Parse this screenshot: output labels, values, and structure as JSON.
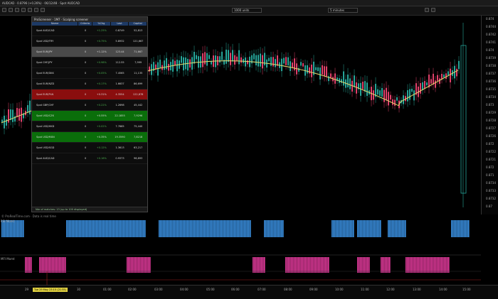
{
  "window": {
    "title": "AUDCAD · 0.8796 (+0.26%) · 06/12/48 · Spot AUDCAD"
  },
  "toolbar": {
    "units_label": "1000 units",
    "timeframe_label": "5 minutes"
  },
  "screener": {
    "header": "ProScreener · 1M7 · Scalping screener",
    "columns": [
      "Name",
      "Criteria",
      "%Chg",
      "Last",
      "Capital"
    ],
    "rows": [
      {
        "name": "Spot AUD/CAD",
        "criteria": "0",
        "chg": "+1.25%",
        "last": "0.8749",
        "cap": "52,813",
        "bg": "#0d0d0d"
      },
      {
        "name": "Spot USD/TRY",
        "criteria": "0",
        "chg": "+0.75%",
        "last": "5.8932",
        "cap": "121,667",
        "bg": "#0d0d0d"
      },
      {
        "name": "Spot EUR/JPY",
        "criteria": "0",
        "chg": "+1.12%",
        "last": "123.44",
        "cap": "71,667",
        "bg": "#4a4a4a"
      },
      {
        "name": "Spot CHF/JPY",
        "criteria": "0",
        "chg": "+0.98%",
        "last": "112.55",
        "cap": "7,999",
        "bg": "#0d0d0d"
      },
      {
        "name": "Spot EUR/DKK",
        "criteria": "0",
        "chg": "+0.05%",
        "last": "7.4565",
        "cap": "11,135",
        "bg": "#0d0d0d"
      },
      {
        "name": "Spot EUR/NZD",
        "criteria": "0",
        "chg": "+0.17%",
        "last": "1.6637",
        "cap": "86,699",
        "bg": "#0d0d0d"
      },
      {
        "name": "Spot EUR/PLN",
        "criteria": "0",
        "chg": "+0.31%",
        "last": "4.3554",
        "cap": "122,878",
        "bg": "#8a0e0e"
      },
      {
        "name": "Spot GBP/CHF",
        "criteria": "0",
        "chg": "+0.22%",
        "last": "1.2698",
        "cap": "45,442",
        "bg": "#0d0d0d"
      },
      {
        "name": "Spot USD/CZK",
        "criteria": "0",
        "chg": "+0.55%",
        "last": "22.1855",
        "cap": "7,9296",
        "bg": "#0a6e0a"
      },
      {
        "name": "Spot USD/HKD",
        "criteria": "0",
        "chg": "+0.02%",
        "last": "7.7665",
        "cap": "75,440",
        "bg": "#0d0d0d"
      },
      {
        "name": "Spot USD/MXN",
        "criteria": "0",
        "chg": "+0.35%",
        "last": "19.3590",
        "cap": "7,8218",
        "bg": "#0a6e0a"
      },
      {
        "name": "Spot USD/SGD",
        "criteria": "0",
        "chg": "+0.12%",
        "last": "1.3613",
        "cap": "63,217",
        "bg": "#0d0d0d"
      },
      {
        "name": "Spot AUD/CAD",
        "criteria": "0",
        "chg": "+0.16%",
        "last": "0.9373",
        "cap": "96,893",
        "bg": "#0d0d0d"
      }
    ],
    "footer": "Nbr of matches: 13 (up to 100 displayed)"
  },
  "price_axis": [
    "0.874",
    "0.8744",
    "0.8742",
    "0.8741",
    "0.874",
    "0.8739",
    "0.8738",
    "0.8737",
    "0.8736",
    "0.8735",
    "0.8734",
    "0.873",
    "0.8729",
    "0.8728",
    "0.8727",
    "0.8726",
    "0.872",
    "0.8722",
    "0.8721",
    "0.872",
    "0.871",
    "0.8734",
    "0.8733",
    "0.8732",
    "0.87"
  ],
  "status_line": "© ProRealTime.com · Data is real time",
  "indicator1": {
    "label": "RSI Momt"
  },
  "indicator2": {
    "label": "MFI Momt"
  },
  "time_axis": {
    "labels": [
      "29",
      "30",
      "01:00",
      "02:00",
      "03:00",
      "04:00",
      "05:00",
      "06:00",
      "07:00",
      "08:00",
      "09:00",
      "10:00",
      "11:00",
      "12:00",
      "13:00",
      "14:00",
      "15:00"
    ],
    "cursor": "Tue 29 May 23:15 (21:55)"
  },
  "colors": {
    "bull": "#26a69a",
    "bear": "#e0406a",
    "ma": "#e6dc6e",
    "hist_up": "#3a8fe0",
    "hist_down": "#e03a9a"
  }
}
